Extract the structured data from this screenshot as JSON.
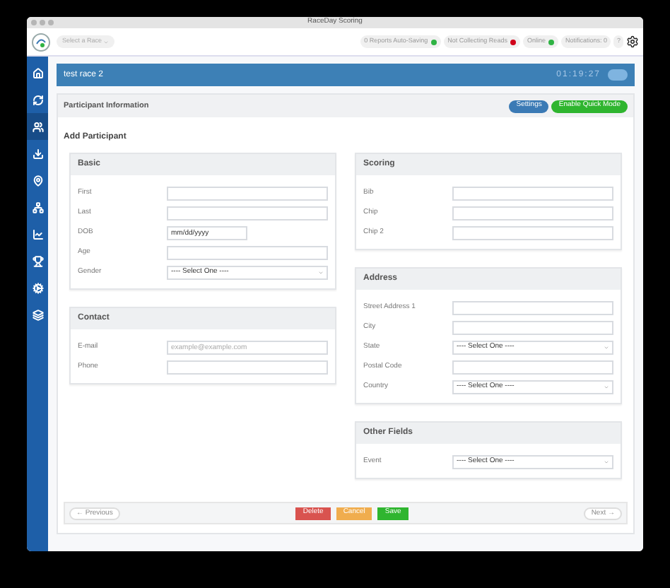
{
  "window": {
    "title": "RaceDay Scoring"
  },
  "toolbar": {
    "race_select": {
      "value": "Select a Race"
    },
    "statuses": [
      {
        "label": "0 Reports Auto-Saving",
        "color": "#2fb344"
      },
      {
        "label": "Not Collecting Reads",
        "color": "#d0021b"
      },
      {
        "label": "Online",
        "color": "#2fb344"
      }
    ],
    "notifications": "Notifications: 0",
    "help": "?"
  },
  "sidebar": {
    "items": [
      {
        "kind": "home",
        "selected": false
      },
      {
        "kind": "sync",
        "selected": false
      },
      {
        "kind": "users",
        "selected": true
      },
      {
        "kind": "download",
        "selected": false
      },
      {
        "kind": "pin",
        "selected": false
      },
      {
        "kind": "tree",
        "selected": false
      },
      {
        "kind": "chart",
        "selected": false
      },
      {
        "kind": "trophy",
        "selected": false
      },
      {
        "kind": "cogs",
        "selected": false
      },
      {
        "kind": "layers",
        "selected": false
      }
    ]
  },
  "race_bar": {
    "name": "test race 2",
    "timer": "01:19:27"
  },
  "panel": {
    "title": "Participant Information",
    "buttons": [
      {
        "label": "Settings",
        "kind": "primary"
      },
      {
        "label": "Enable Quick Mode",
        "kind": "success"
      }
    ],
    "heading": "Add Participant",
    "columns": [
      [
        {
          "title": "Basic",
          "fields": [
            {
              "label": "First",
              "kind": "text"
            },
            {
              "label": "Last",
              "kind": "text"
            },
            {
              "label": "DOB",
              "kind": "date",
              "placeholder": "mm/dd/yyyy"
            },
            {
              "label": "Age",
              "kind": "text"
            },
            {
              "label": "Gender",
              "kind": "select",
              "value": "---- Select One ----"
            }
          ]
        },
        {
          "title": "Contact",
          "fields": [
            {
              "label": "E-mail",
              "kind": "text",
              "placeholder": "example@example.com"
            },
            {
              "label": "Phone",
              "kind": "text"
            }
          ]
        }
      ],
      [
        {
          "title": "Scoring",
          "fields": [
            {
              "label": "Bib",
              "kind": "text"
            },
            {
              "label": "Chip",
              "kind": "text"
            },
            {
              "label": "Chip 2",
              "kind": "text"
            }
          ]
        },
        {
          "title": "Address",
          "fields": [
            {
              "label": "Street Address 1",
              "kind": "text"
            },
            {
              "label": "City",
              "kind": "text"
            },
            {
              "label": "State",
              "kind": "select",
              "value": "---- Select One ----"
            },
            {
              "label": "Postal Code",
              "kind": "text"
            },
            {
              "label": "Country",
              "kind": "select",
              "value": "---- Select One ----"
            }
          ]
        },
        {
          "title": "Other Fields",
          "fields": [
            {
              "label": "Event",
              "kind": "select",
              "value": "---- Select One ----"
            }
          ]
        }
      ]
    ],
    "footer": {
      "previous": "← Previous",
      "actions": [
        {
          "label": "Delete",
          "kind": "danger"
        },
        {
          "label": "Cancel",
          "kind": "warning"
        },
        {
          "label": "Save",
          "kind": "success"
        }
      ],
      "next": "Next →"
    }
  }
}
